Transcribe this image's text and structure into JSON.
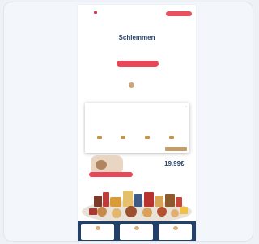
{
  "header": {
    "logo_text": "",
    "nav_text": "",
    "cta": ""
  },
  "hero": {
    "title": "Schlemmen",
    "subtitle": "",
    "description": "",
    "cta": ""
  },
  "small_text": "",
  "reviewer": "",
  "modal": {
    "tabs": [
      "",
      "",
      ""
    ],
    "close": "×",
    "title": "",
    "body": "",
    "options": [
      "",
      "",
      "",
      ""
    ],
    "cta": ""
  },
  "promo": {
    "badge": "",
    "old_price": "",
    "price_label": "",
    "price": "19,99€"
  },
  "bottom_cards": [
    "",
    "",
    ""
  ],
  "colors": {
    "accent": "#e9465a",
    "brand_blue": "#26446d",
    "footer": "#21406a",
    "gold": "#c49d6b"
  }
}
